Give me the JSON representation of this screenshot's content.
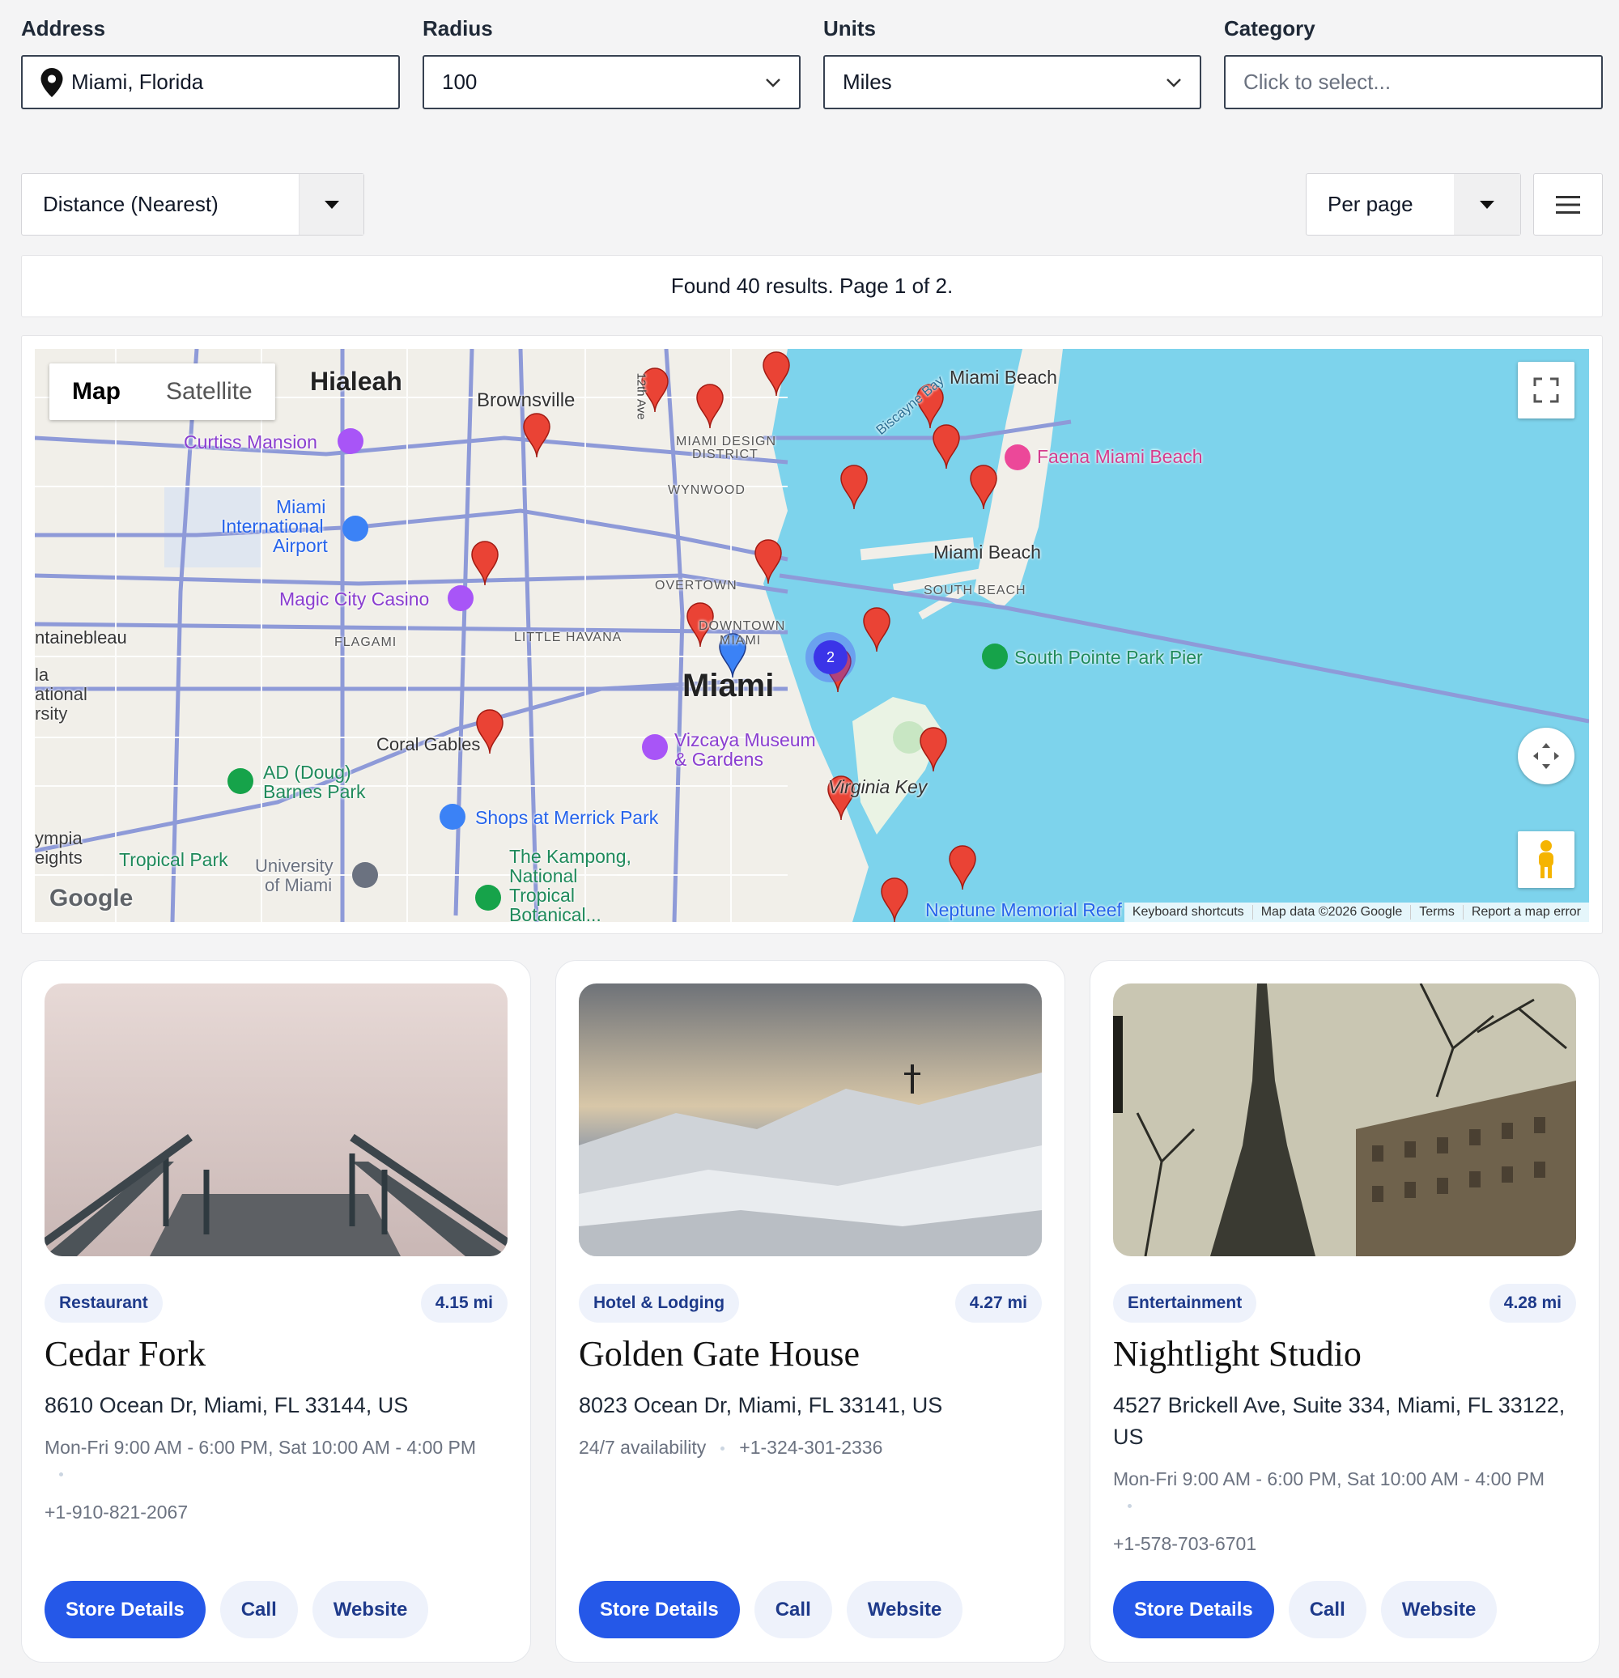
{
  "filters": {
    "address_label": "Address",
    "address_value": "Miami, Florida",
    "radius_label": "Radius",
    "radius_value": "100",
    "units_label": "Units",
    "units_value": "Miles",
    "category_label": "Category",
    "category_placeholder": "Click to select..."
  },
  "toolbar": {
    "sort_value": "Distance (Nearest)",
    "per_page_value": "Per page"
  },
  "results_text": "Found 40 results. Page 1 of 2.",
  "map": {
    "type_map": "Map",
    "type_satellite": "Satellite",
    "cluster_count": "2",
    "logo": "Google",
    "attribution": {
      "shortcuts": "Keyboard shortcuts",
      "data": "Map data ©2026 Google",
      "terms": "Terms",
      "report": "Report a map error"
    },
    "labels": {
      "hialeah": "Hialeah",
      "brownsville": "Brownsville",
      "curtiss": "Curtiss Mansion",
      "airport1": "Miami",
      "airport2": "International",
      "airport3": "Airport",
      "casino": "Magic City Casino",
      "fontainebleau": "ntainebleau",
      "flagami": "FLAGAMI",
      "little_havana": "LITTLE HAVANA",
      "miami": "Miami",
      "downtown": "DOWNTOWN",
      "downtown2": "MIAMI",
      "overtown": "OVERTOWN",
      "wynwood": "WYNWOOD",
      "design_district": "MIAMI DESIGN",
      "design_district2": "DISTRICT",
      "miami_beach_top": "Miami Beach",
      "miami_beach": "Miami Beach",
      "south_beach": "SOUTH BEACH",
      "faena": "Faena Miami Beach",
      "south_pointe": "South Pointe Park Pier",
      "coral_gables": "Coral Gables",
      "vizcaya1": "Vizcaya Museum",
      "vizcaya2": "& Gardens",
      "virginia_key": "Virginia Key",
      "barnes1": "AD (Doug)",
      "barnes2": "Barnes Park",
      "merrick": "Shops at Merrick Park",
      "tropical_park": "Tropical Park",
      "um1": "University",
      "um2": "of Miami",
      "kampong1": "The Kampong,",
      "kampong2": "National",
      "kampong3": "Tropical",
      "kampong4": "Botanical...",
      "neptune": "Neptune Memorial Reef",
      "olympia1": "ympia",
      "olympia2": "eights",
      "fiu1": "la",
      "fiu2": "ational",
      "fiu3": "rsity",
      "biscayne": "Biscayne Bay",
      "avenue": "12th Ave"
    }
  },
  "cards": [
    {
      "category": "Restaurant",
      "distance": "4.15 mi",
      "name": "Cedar Fork",
      "address": "8610 Ocean Dr, Miami, FL 33144, US",
      "hours": "Mon-Fri 9:00 AM - 6:00 PM, Sat 10:00 AM - 4:00 PM",
      "phone": "+1-910-821-2067",
      "btn_details": "Store Details",
      "btn_call": "Call",
      "btn_website": "Website"
    },
    {
      "category": "Hotel & Lodging",
      "distance": "4.27 mi",
      "name": "Golden Gate House",
      "address": "8023 Ocean Dr, Miami, FL 33141, US",
      "hours": "24/7 availability",
      "phone": "+1-324-301-2336",
      "btn_details": "Store Details",
      "btn_call": "Call",
      "btn_website": "Website"
    },
    {
      "category": "Entertainment",
      "distance": "4.28 mi",
      "name": "Nightlight Studio",
      "address": "4527 Brickell Ave, Suite 334, Miami, FL 33122, US",
      "hours": "Mon-Fri 9:00 AM - 6:00 PM, Sat 10:00 AM - 4:00 PM",
      "phone": "+1-578-703-6701",
      "btn_details": "Store Details",
      "btn_call": "Call",
      "btn_website": "Website"
    }
  ]
}
